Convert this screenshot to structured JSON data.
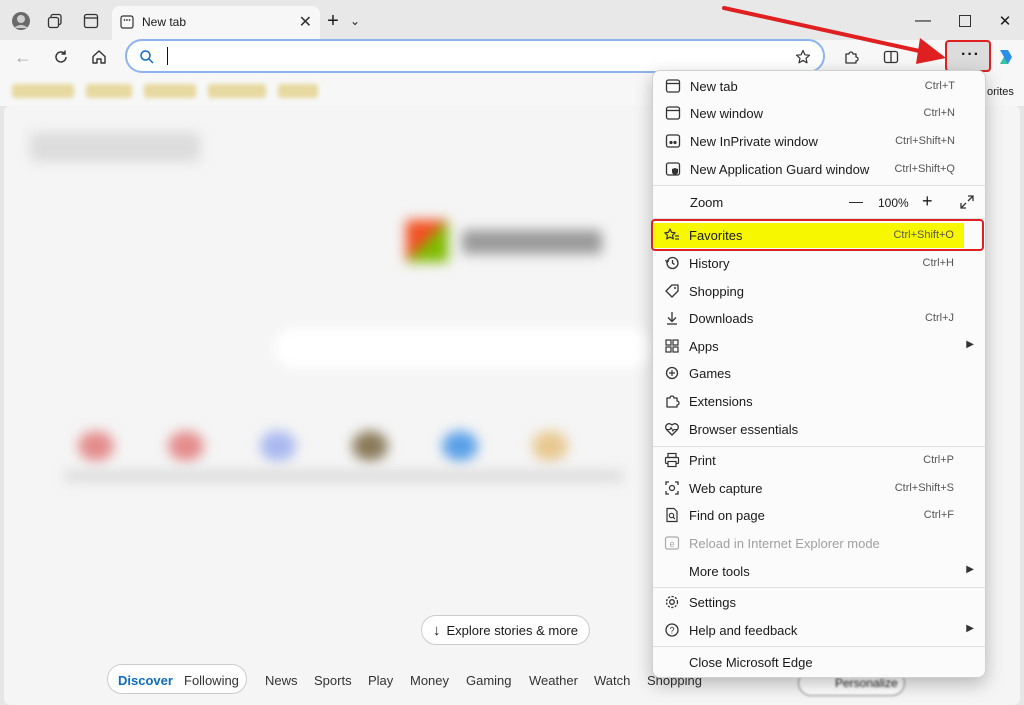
{
  "tab": {
    "title": "New tab"
  },
  "address": {
    "placeholder": ""
  },
  "favorites_bar": {
    "overflow_label": "orites"
  },
  "page": {
    "explore_label": "Explore stories & more",
    "nav": [
      "Discover",
      "Following",
      "News",
      "Sports",
      "Play",
      "Money",
      "Gaming",
      "Weather",
      "Watch",
      "Shopping"
    ],
    "personalize_label": "Personalize"
  },
  "menu": {
    "new_tab": {
      "label": "New tab",
      "shortcut": "Ctrl+T"
    },
    "new_window": {
      "label": "New window",
      "shortcut": "Ctrl+N"
    },
    "new_inprivate": {
      "label": "New InPrivate window",
      "shortcut": "Ctrl+Shift+N"
    },
    "new_app_guard": {
      "label": "New Application Guard window",
      "shortcut": "Ctrl+Shift+Q"
    },
    "zoom": {
      "label": "Zoom",
      "value": "100%",
      "minus": "—",
      "plus": "+"
    },
    "favorites": {
      "label": "Favorites",
      "shortcut": "Ctrl+Shift+O"
    },
    "history": {
      "label": "History",
      "shortcut": "Ctrl+H"
    },
    "shopping": {
      "label": "Shopping"
    },
    "downloads": {
      "label": "Downloads",
      "shortcut": "Ctrl+J"
    },
    "apps": {
      "label": "Apps"
    },
    "games": {
      "label": "Games"
    },
    "extensions": {
      "label": "Extensions"
    },
    "browser_essentials": {
      "label": "Browser essentials"
    },
    "print": {
      "label": "Print",
      "shortcut": "Ctrl+P"
    },
    "web_capture": {
      "label": "Web capture",
      "shortcut": "Ctrl+Shift+S"
    },
    "find_on_page": {
      "label": "Find on page",
      "shortcut": "Ctrl+F"
    },
    "reload_ie": {
      "label": "Reload in Internet Explorer mode"
    },
    "more_tools": {
      "label": "More tools"
    },
    "settings": {
      "label": "Settings"
    },
    "help": {
      "label": "Help and feedback"
    },
    "close": {
      "label": "Close Microsoft Edge"
    }
  },
  "colors": {
    "highlight": "#f7f700",
    "annotation_red": "#e02020",
    "accent": "#0f6cbd"
  }
}
